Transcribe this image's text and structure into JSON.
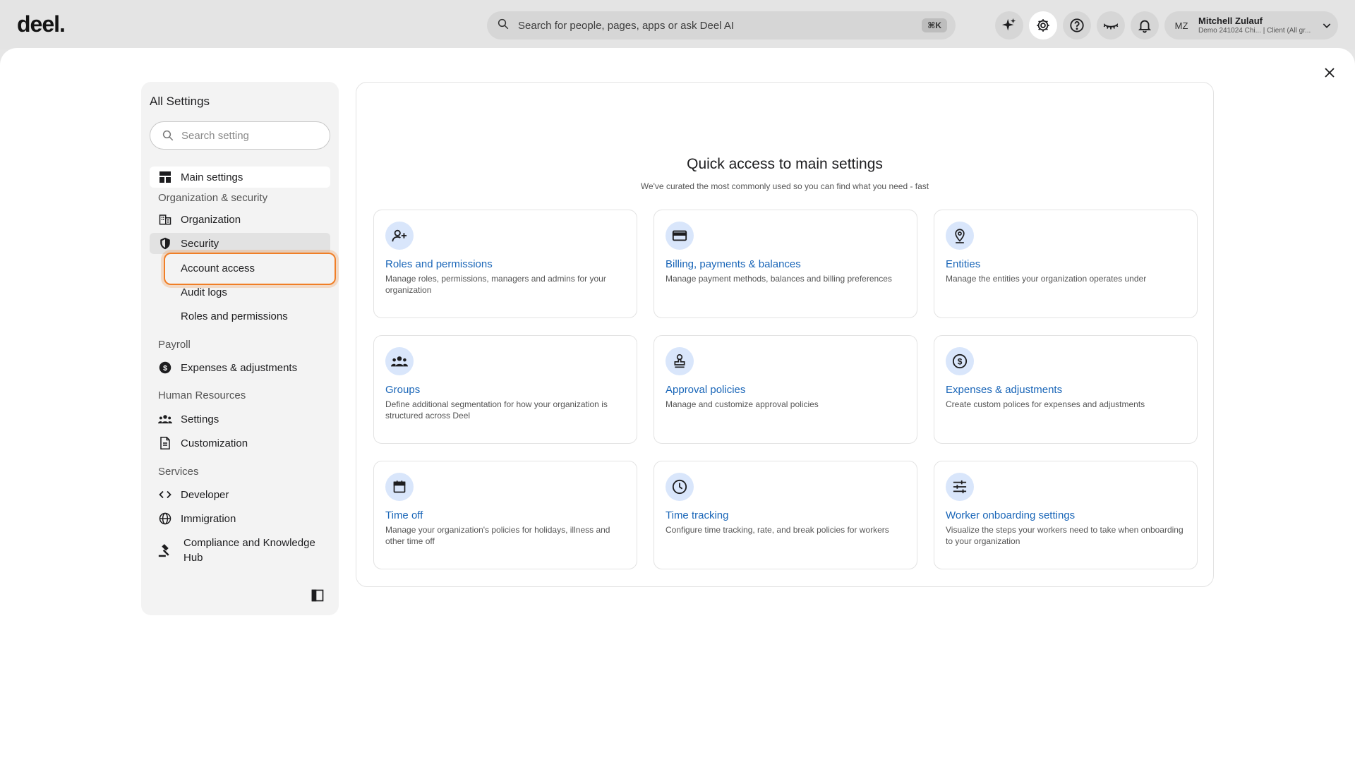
{
  "topbar": {
    "logo": "deel.",
    "search_placeholder": "Search for people, pages, apps or ask Deel AI",
    "shortcut": "⌘K",
    "profile": {
      "initials": "MZ",
      "name": "Mitchell Zulauf",
      "subtitle": "Demo 241024 Chi... | Client (All gr..."
    }
  },
  "sidebar": {
    "title": "All Settings",
    "search_placeholder": "Search setting",
    "main_settings": "Main settings",
    "groups": {
      "org_security": "Organization & security",
      "payroll": "Payroll",
      "hr": "Human Resources",
      "services": "Services"
    },
    "items": {
      "organization": "Organization",
      "security": "Security",
      "account_access": "Account access",
      "audit_logs": "Audit logs",
      "roles_permissions": "Roles and permissions",
      "expenses": "Expenses & adjustments",
      "settings": "Settings",
      "customization": "Customization",
      "developer": "Developer",
      "immigration": "Immigration",
      "compliance": "Compliance and Knowledge Hub"
    }
  },
  "content": {
    "title": "Quick access to main settings",
    "subtitle": "We've curated the most commonly used so you can find what you need - fast",
    "tiles": [
      {
        "title": "Roles and permissions",
        "desc": "Manage roles, permissions, managers and admins for your organization",
        "icon": "person-add-icon"
      },
      {
        "title": "Billing, payments & balances",
        "desc": "Manage payment methods, balances and billing preferences",
        "icon": "credit-card-icon"
      },
      {
        "title": "Entities",
        "desc": "Manage the entities your organization operates under",
        "icon": "location-pin-icon"
      },
      {
        "title": "Groups",
        "desc": "Define additional segmentation for how your organization is structured across Deel",
        "icon": "groups-icon"
      },
      {
        "title": "Approval policies",
        "desc": "Manage and customize approval policies",
        "icon": "stamp-icon"
      },
      {
        "title": "Expenses & adjustments",
        "desc": "Create custom polices for expenses and adjustments",
        "icon": "dollar-circle-icon"
      },
      {
        "title": "Time off",
        "desc": "Manage your organization's policies for holidays, illness and other time off",
        "icon": "calendar-icon"
      },
      {
        "title": "Time tracking",
        "desc": "Configure time tracking, rate, and break policies for workers",
        "icon": "clock-icon"
      },
      {
        "title": "Worker onboarding settings",
        "desc": "Visualize the steps your workers need to take when onboarding to your organization",
        "icon": "sliders-icon"
      }
    ]
  }
}
